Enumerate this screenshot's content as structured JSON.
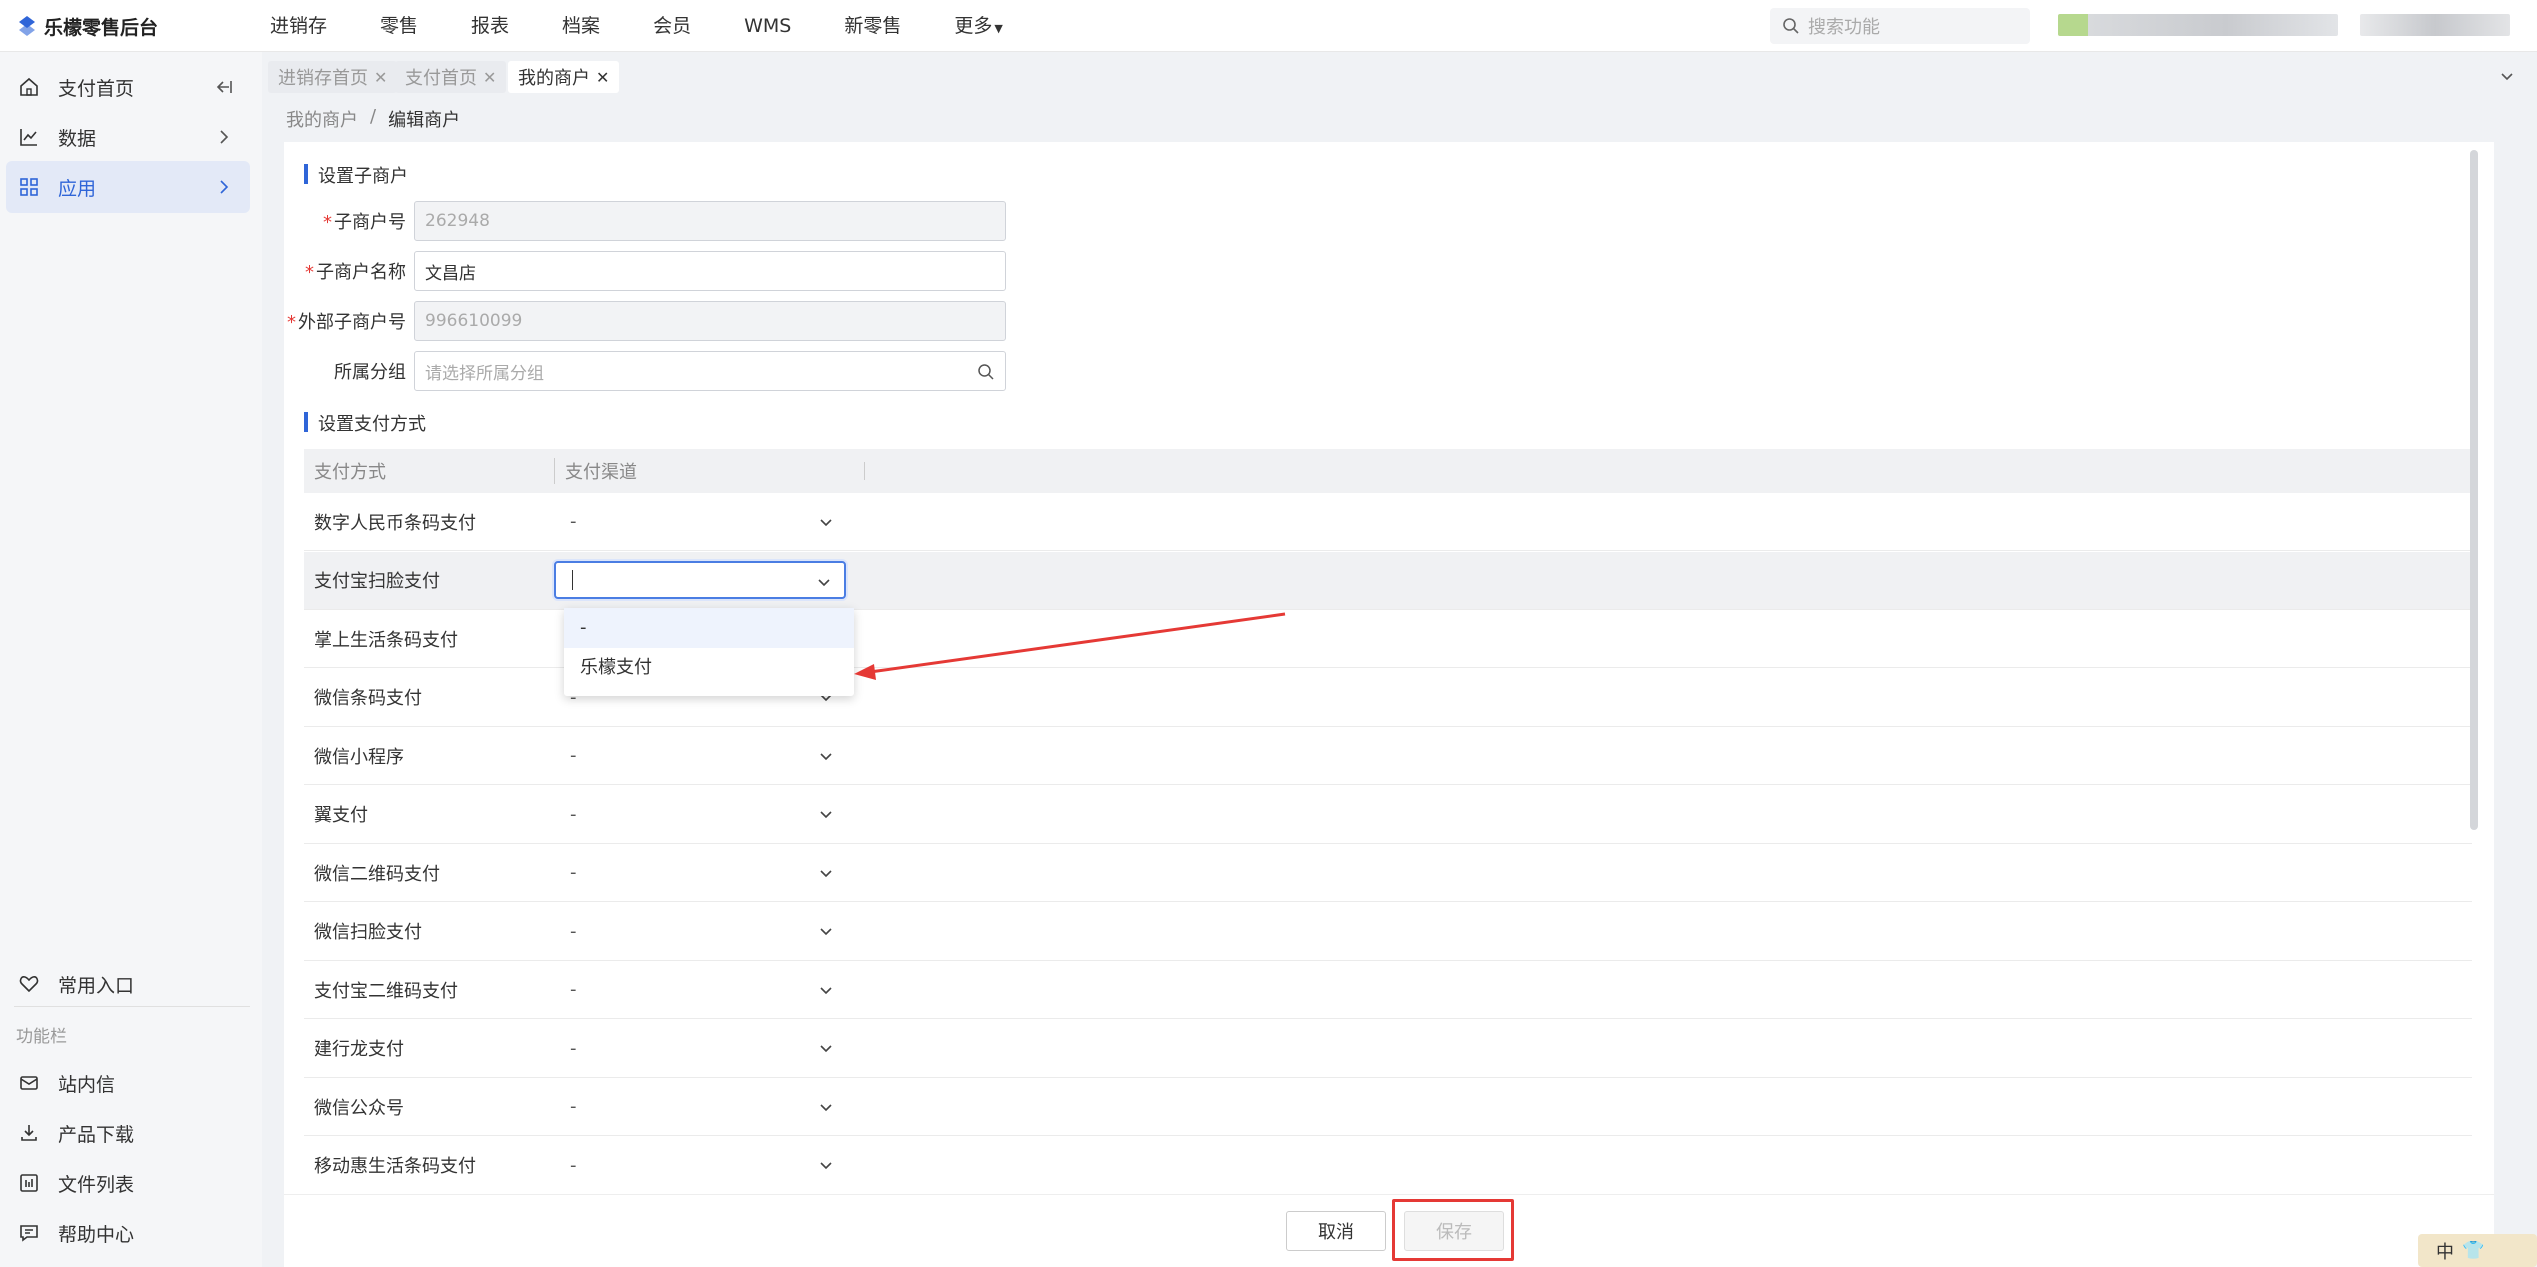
{
  "app": {
    "title": "乐檬零售后台"
  },
  "nav": {
    "items": [
      "进销存",
      "零售",
      "报表",
      "档案",
      "会员",
      "WMS",
      "新零售",
      "更多"
    ]
  },
  "search": {
    "placeholder": "搜索功能"
  },
  "sidebar": {
    "items": [
      {
        "label": "支付首页",
        "icon": "home-icon"
      },
      {
        "label": "数据",
        "icon": "chart-line-icon"
      },
      {
        "label": "应用",
        "icon": "apps-grid-icon"
      }
    ],
    "favorites": "常用入口",
    "section_label": "功能栏",
    "tools": [
      {
        "label": "站内信",
        "icon": "mail-icon"
      },
      {
        "label": "产品下载",
        "icon": "download-icon"
      },
      {
        "label": "文件列表",
        "icon": "file-list-icon"
      },
      {
        "label": "帮助中心",
        "icon": "help-chat-icon"
      }
    ]
  },
  "tabs": [
    "进销存首页",
    "支付首页",
    "我的商户"
  ],
  "breadcrumb": {
    "parent": "我的商户",
    "separator": "/",
    "current": "编辑商户"
  },
  "form": {
    "section_title": "设置子商户",
    "merchant_no": {
      "label": "子商户号",
      "value": "262948"
    },
    "merchant_name": {
      "label": "子商户名称",
      "value": "文昌店"
    },
    "external_no": {
      "label": "外部子商户号",
      "value": "996610099"
    },
    "group": {
      "label": "所属分组",
      "placeholder": "请选择所属分组"
    }
  },
  "payment": {
    "section_title": "设置支付方式",
    "col_method": "支付方式",
    "col_channel": "支付渠道",
    "rows": [
      {
        "method": "数字人民币条码支付",
        "channel": "-"
      },
      {
        "method": "支付宝扫脸支付",
        "channel": ""
      },
      {
        "method": "掌上生活条码支付",
        "channel": "-"
      },
      {
        "method": "微信条码支付",
        "channel": "-"
      },
      {
        "method": "微信小程序",
        "channel": "-"
      },
      {
        "method": "翼支付",
        "channel": "-"
      },
      {
        "method": "微信二维码支付",
        "channel": "-"
      },
      {
        "method": "微信扫脸支付",
        "channel": "-"
      },
      {
        "method": "支付宝二维码支付",
        "channel": "-"
      },
      {
        "method": "建行龙支付",
        "channel": "-"
      },
      {
        "method": "微信公众号",
        "channel": "-"
      },
      {
        "method": "移动惠生活条码支付",
        "channel": "-"
      }
    ],
    "dropdown_options": [
      "-",
      "乐檬支付"
    ]
  },
  "buttons": {
    "cancel": "取消",
    "save": "保存"
  },
  "ime": {
    "label": "中"
  },
  "colors": {
    "accent": "#2f65d8",
    "annotation": "#e53935"
  }
}
